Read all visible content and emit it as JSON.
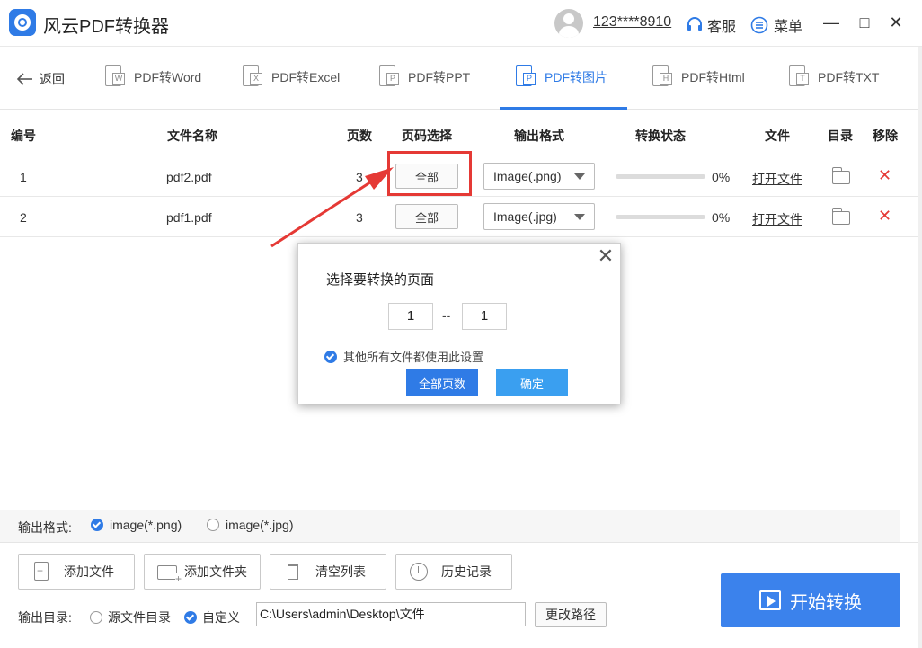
{
  "window": {
    "app_title": "风云PDF转换器",
    "user": "123****8910",
    "service_label": "客服",
    "menu_label": "菜单",
    "minimize_icon": "—",
    "maximize_icon": "□",
    "close_icon": "✕"
  },
  "toolbar": {
    "back_label": "返回",
    "tabs": [
      {
        "label": "PDF转Word",
        "badge": "W"
      },
      {
        "label": "PDF转Excel",
        "badge": "X"
      },
      {
        "label": "PDF转PPT",
        "badge": "P"
      },
      {
        "label": "PDF转图片",
        "badge": "P"
      },
      {
        "label": "PDF转Html",
        "badge": "H"
      },
      {
        "label": "PDF转TXT",
        "badge": "T"
      }
    ],
    "active_tab": "PDF转图片"
  },
  "table": {
    "headers": {
      "index": "编号",
      "name": "文件名称",
      "pages": "页数",
      "page_select": "页码选择",
      "output_format": "输出格式",
      "status": "转换状态",
      "file": "文件",
      "folder": "目录",
      "remove": "移除"
    },
    "rows": [
      {
        "index": "1",
        "name": "pdf2.pdf",
        "pages": "3",
        "page_select": "全部",
        "format": "Image(.png)",
        "progress": "0%",
        "progress_value": 0,
        "open": "打开文件",
        "remove": "✕"
      },
      {
        "index": "2",
        "name": "pdf1.pdf",
        "pages": "3",
        "page_select": "全部",
        "format": "Image(.jpg)",
        "progress": "0%",
        "progress_value": 0,
        "open": "打开文件",
        "remove": "✕"
      }
    ]
  },
  "dialog": {
    "title": "选择要转换的页面",
    "close": "✕",
    "from_value": "1",
    "separator": "--",
    "to_value": "1",
    "apply_all_label": "其他所有文件都使用此设置",
    "apply_all_checked": true,
    "all_pages_button": "全部页数",
    "confirm_button": "确定"
  },
  "output_format": {
    "label": "输出格式:",
    "options": [
      {
        "label": "image(*.png)",
        "selected": true
      },
      {
        "label": "image(*.jpg)",
        "selected": false
      }
    ]
  },
  "actions": {
    "add_file": "添加文件",
    "add_folder": "添加文件夹",
    "clear_list": "清空列表",
    "history": "历史记录"
  },
  "output_dir": {
    "label": "输出目录:",
    "source_option": "源文件目录",
    "custom_option": "自定义",
    "custom_selected": true,
    "path": "C:\\Users\\admin\\Desktop\\文件",
    "change_button": "更改路径"
  },
  "start_button": "开始转换",
  "colors": {
    "accent": "#2f7be6",
    "start_button": "#3b82ec",
    "highlight": "#e53935",
    "dialog_all_pages": "#2f7be6",
    "dialog_confirm": "#3a9ff0"
  }
}
